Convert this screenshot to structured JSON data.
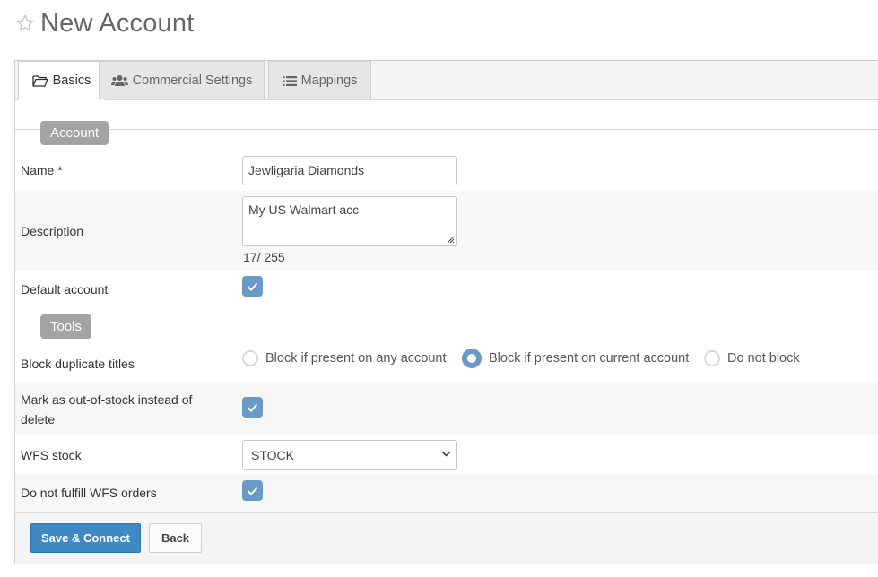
{
  "page": {
    "title": "New Account"
  },
  "tabs": [
    {
      "label": "Basics",
      "icon": "folder-open-icon"
    },
    {
      "label": "Commercial Settings",
      "icon": "users-icon"
    },
    {
      "label": "Mappings",
      "icon": "list-icon"
    }
  ],
  "account_section": {
    "legend": "Account",
    "name": {
      "label": "Name *",
      "value": "Jewligaria Diamonds"
    },
    "description": {
      "label": "Description",
      "value": "My US Walmart acc",
      "counter": "17/ 255"
    },
    "default_account": {
      "label": "Default account",
      "checked": true
    }
  },
  "tools_section": {
    "legend": "Tools",
    "block_duplicates": {
      "label": "Block duplicate titles",
      "options": [
        "Block if present on any account",
        "Block if present on current account",
        "Do not block"
      ],
      "selected": "Block if present on current account"
    },
    "mark_oos": {
      "label_line1": "Mark as out-of-stock instead of",
      "label_line2": "delete",
      "checked": true
    },
    "wfs_stock": {
      "label": "WFS stock",
      "value": "STOCK"
    },
    "no_fulfill_wfs": {
      "label": "Do not fulfill WFS orders",
      "checked": true
    }
  },
  "footer": {
    "save_label": "Save & Connect",
    "back_label": "Back"
  },
  "colors": {
    "accent": "#6a9bc7",
    "primary_button": "#3e8ac4",
    "legend_bg": "#a3a3a3"
  }
}
